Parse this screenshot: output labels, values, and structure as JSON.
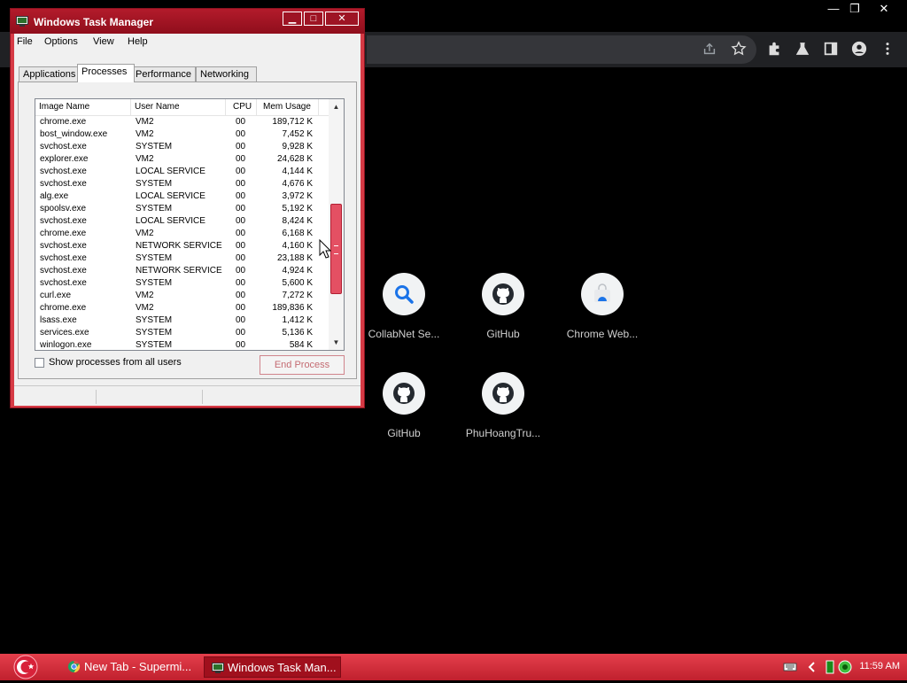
{
  "chrome": {
    "window_controls": [
      "—",
      "❐",
      "✕"
    ],
    "toolbar_icons": [
      "share-icon",
      "star-icon",
      "extensions-icon",
      "labs-icon",
      "sidepanel-icon",
      "profile-icon",
      "menu-icon"
    ]
  },
  "shortcuts": [
    {
      "label": "CollabNet Se...",
      "icon": "search-icon"
    },
    {
      "label": "GitHub",
      "icon": "github-icon"
    },
    {
      "label": "Chrome Web...",
      "icon": "chrome-web-store-icon"
    },
    {
      "label": "GitHub",
      "icon": "github-icon"
    },
    {
      "label": "PhuHoangTru...",
      "icon": "github-icon"
    }
  ],
  "task_manager": {
    "title": "Windows Task Manager",
    "window_buttons": {
      "minimize": "▁",
      "maximize": "□",
      "close": "✕"
    },
    "menu": [
      "File",
      "Options",
      "View",
      "Help"
    ],
    "tabs": [
      "Applications",
      "Processes",
      "Performance",
      "Networking"
    ],
    "active_tab": "Processes",
    "columns": [
      "Image Name",
      "User Name",
      "CPU",
      "Mem Usage"
    ],
    "processes": [
      {
        "name": "chrome.exe",
        "user": "VM2",
        "cpu": "00",
        "mem": "189,712 K"
      },
      {
        "name": "bost_window.exe",
        "user": "VM2",
        "cpu": "00",
        "mem": "7,452 K"
      },
      {
        "name": "svchost.exe",
        "user": "SYSTEM",
        "cpu": "00",
        "mem": "9,928 K"
      },
      {
        "name": "explorer.exe",
        "user": "VM2",
        "cpu": "00",
        "mem": "24,628 K"
      },
      {
        "name": "svchost.exe",
        "user": "LOCAL SERVICE",
        "cpu": "00",
        "mem": "4,144 K"
      },
      {
        "name": "svchost.exe",
        "user": "SYSTEM",
        "cpu": "00",
        "mem": "4,676 K"
      },
      {
        "name": "alg.exe",
        "user": "LOCAL SERVICE",
        "cpu": "00",
        "mem": "3,972 K"
      },
      {
        "name": "spoolsv.exe",
        "user": "SYSTEM",
        "cpu": "00",
        "mem": "5,192 K"
      },
      {
        "name": "svchost.exe",
        "user": "LOCAL SERVICE",
        "cpu": "00",
        "mem": "8,424 K"
      },
      {
        "name": "chrome.exe",
        "user": "VM2",
        "cpu": "00",
        "mem": "6,168 K"
      },
      {
        "name": "svchost.exe",
        "user": "NETWORK SERVICE",
        "cpu": "00",
        "mem": "4,160 K"
      },
      {
        "name": "svchost.exe",
        "user": "SYSTEM",
        "cpu": "00",
        "mem": "23,188 K"
      },
      {
        "name": "svchost.exe",
        "user": "NETWORK SERVICE",
        "cpu": "00",
        "mem": "4,924 K"
      },
      {
        "name": "svchost.exe",
        "user": "SYSTEM",
        "cpu": "00",
        "mem": "5,600 K"
      },
      {
        "name": "curl.exe",
        "user": "VM2",
        "cpu": "00",
        "mem": "7,272 K"
      },
      {
        "name": "chrome.exe",
        "user": "VM2",
        "cpu": "00",
        "mem": "189,836 K"
      },
      {
        "name": "lsass.exe",
        "user": "SYSTEM",
        "cpu": "00",
        "mem": "1,412 K"
      },
      {
        "name": "services.exe",
        "user": "SYSTEM",
        "cpu": "00",
        "mem": "5,136 K"
      },
      {
        "name": "winlogon.exe",
        "user": "SYSTEM",
        "cpu": "00",
        "mem": "584 K"
      }
    ],
    "show_all_label": "Show processes from all users",
    "end_process_label": "End Process"
  },
  "taskbar": {
    "items": [
      {
        "label": "New Tab - Supermi...",
        "icon": "chrome-icon",
        "active": false
      },
      {
        "label": "Windows Task Man...",
        "icon": "task-manager-icon",
        "active": true
      }
    ],
    "tray_icons": [
      "keyboard-icon",
      "chevron-left-icon",
      "battery-icon",
      "network-icon"
    ],
    "clock": "11:59 AM"
  },
  "colors": {
    "accent": "#c0202e",
    "scroll_thumb": "#e45063"
  }
}
